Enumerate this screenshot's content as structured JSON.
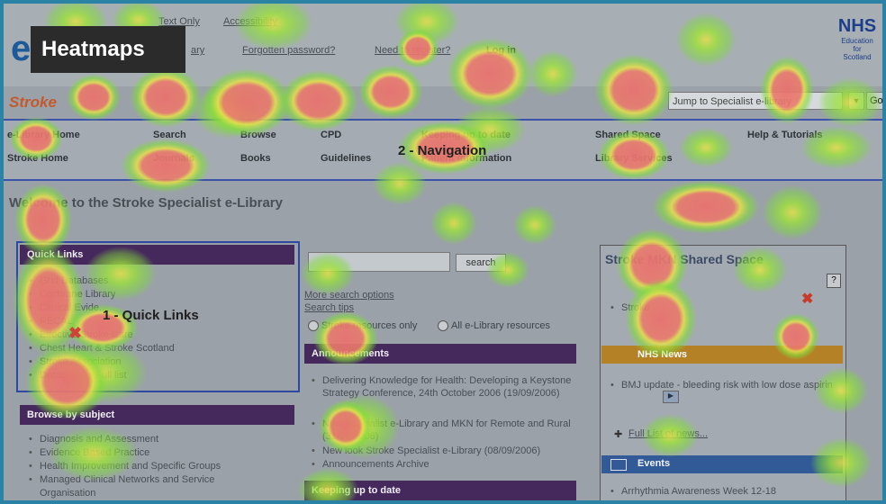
{
  "overlay_title": "Heatmaps",
  "top_links": {
    "text_only": "Text Only",
    "accessibility": "Accessibility"
  },
  "account_links": {
    "ary": "ary",
    "forgotten_password": "Forgotten password?",
    "need_to_register": "Need to register?",
    "log_in": "Log in"
  },
  "brand": {
    "letter": "e",
    "site": "Stroke"
  },
  "nhs": {
    "logo": "NHS",
    "education": "Education",
    "for": "for",
    "scotland": "Scotland"
  },
  "jump": {
    "selected": "Jump to Specialist e-library",
    "go": "Go"
  },
  "nav": {
    "row1": [
      "e-Library Home",
      "Search",
      "Browse",
      "CPD",
      "Keeping up to date",
      "Shared Space",
      "Help & Tutorials"
    ],
    "row2": [
      "Stroke Home",
      "Journals",
      "Books",
      "Guidelines",
      "Patient information",
      "Library Services"
    ]
  },
  "annotations": {
    "navigation": "2 - Navigation",
    "quick_links": "1 - Quick Links"
  },
  "welcome": "Welcome to the Stroke Specialist e-Library",
  "quick_links": {
    "title": "Quick Links",
    "items": [
      "Grid Databases",
      "Cochrane Library",
      "Clinical Evide...",
      "RECAL",
      "Effective Stroke Care",
      "Chest Heart & Stroke Scotland",
      "Stroke Association",
      "Databases - Full list"
    ]
  },
  "browse": {
    "title": "Browse by subject",
    "items": [
      "Diagnosis and Assessment",
      "Evidence Based Practice",
      "Health Improvement and Specific Groups",
      "Managed Clinical Networks and Service",
      "Organisation"
    ]
  },
  "search": {
    "button": "search",
    "more_options": "More search options",
    "tips": "Search tips",
    "radio_stroke": "Stroke resources only",
    "radio_all": "All e-Library resources"
  },
  "announcements": {
    "title": "Announcements",
    "items": [
      "Delivering Knowledge for Health: Developing a Keystone Strategy Conference, 24th October 2006 (19/09/2006)",
      "New Specialist e-Library and MKN for Remote and Rural (31/08/2006)",
      "New look Stroke Specialist e-Library (08/09/2006)"
    ],
    "archive": "Announcements Archive"
  },
  "keeping_up": {
    "title": "Keeping up to date"
  },
  "shared_space": {
    "title": "Stroke MKN Shared Space",
    "item": "Stroke",
    "help_icon_text": "?"
  },
  "news": {
    "title": "NHS News",
    "item": "BMJ update - bleeding risk with low dose aspirin",
    "full_list": "Full List of news..."
  },
  "events": {
    "title": "Events",
    "item": "Arrhythmia Awareness Week 12-18"
  },
  "colors": {
    "heat_red": "#e8726f",
    "heat_yellow": "#e6e04a",
    "heat_green": "#7fdc3a",
    "annotation_box": "#2d4aa0",
    "purple": "#46295c",
    "frame": "#2a82a5"
  }
}
